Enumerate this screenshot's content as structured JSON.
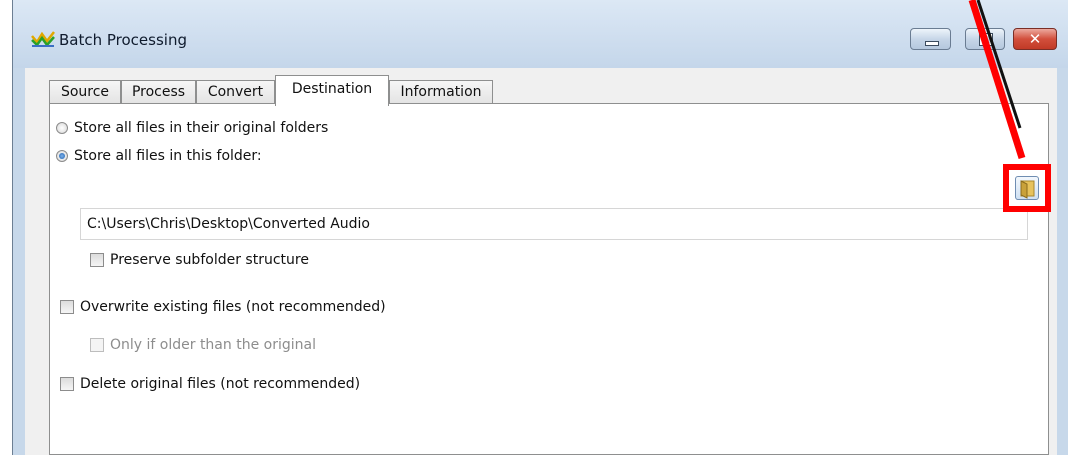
{
  "window": {
    "title": "Batch Processing",
    "icon": "batch-processing-waveform-icon"
  },
  "caption_buttons": {
    "minimize_icon": "minimize-icon",
    "maximize_icon": "maximize-icon",
    "close_icon": "close-icon",
    "close_glyph": "✕"
  },
  "tabs": [
    {
      "label": "Source",
      "active": false
    },
    {
      "label": "Process",
      "active": false
    },
    {
      "label": "Convert",
      "active": false
    },
    {
      "label": "Destination",
      "active": true
    },
    {
      "label": "Information",
      "active": false
    }
  ],
  "destination": {
    "option_original_label": "Store all files in their original folders",
    "option_folder_label": "Store all files in this folder:",
    "selected_option": "Store all files in this folder:",
    "folder_path": "C:\\Users\\Chris\\Desktop\\Converted Audio",
    "browse_icon": "folder-browse-icon",
    "preserve_subfolders_label": "Preserve subfolder structure",
    "preserve_subfolders_checked": false,
    "overwrite_label": "Overwrite existing files (not recommended)",
    "overwrite_checked": false,
    "only_if_older_label": "Only if older than the original",
    "only_if_older_checked": false,
    "only_if_older_enabled": false,
    "delete_original_label": "Delete original files (not recommended)",
    "delete_original_checked": false
  },
  "colors": {
    "annotation_red": "#ff0000",
    "titlebar": "#c7d8ea",
    "close_button": "#c94b39"
  }
}
